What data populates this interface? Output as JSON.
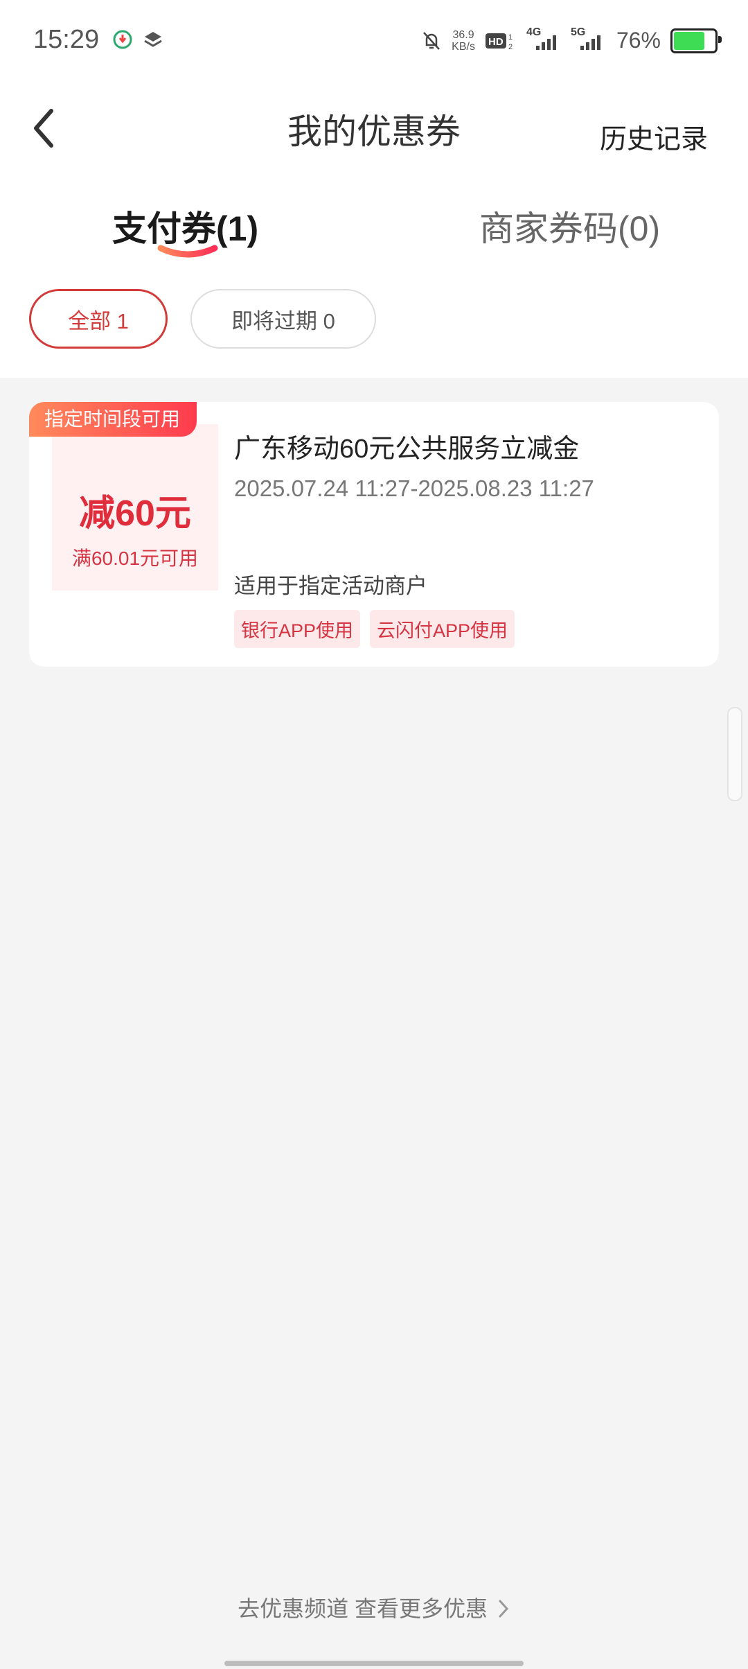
{
  "status_bar": {
    "time": "15:29",
    "net_speed_value": "36.9",
    "net_speed_unit": "KB/s",
    "network_4g": "4G",
    "network_5g": "5G",
    "battery_percent": "76%",
    "battery_level": 0.76,
    "icons": [
      "app-notification-icon",
      "layers-icon",
      "bell-off-icon",
      "hd-icon",
      "signal-4g-icon",
      "signal-5g-icon",
      "battery-icon"
    ]
  },
  "header": {
    "title": "我的优惠券",
    "history": "历史记录"
  },
  "tabs": {
    "payment": "支付券(1)",
    "merchant": "商家券码(0)"
  },
  "filters": {
    "all": "全部 1",
    "expiring": "即将过期 0"
  },
  "coupon": {
    "ribbon": "指定时间段可用",
    "amount": "减60元",
    "condition": "满60.01元可用",
    "name": "广东移动60元公共服务立减金",
    "validity": "2025.07.24 11:27-2025.08.23 11:27",
    "scope": "适用于指定活动商户",
    "tags": [
      "银行APP使用",
      "云闪付APP使用"
    ]
  },
  "footer": {
    "link": "去优惠频道 查看更多优惠"
  },
  "colors": {
    "accent": "#d33b3b",
    "coupon_red": "#e02d3c",
    "tag_bg": "#fde9ea",
    "page_bg": "#f4f4f4"
  }
}
